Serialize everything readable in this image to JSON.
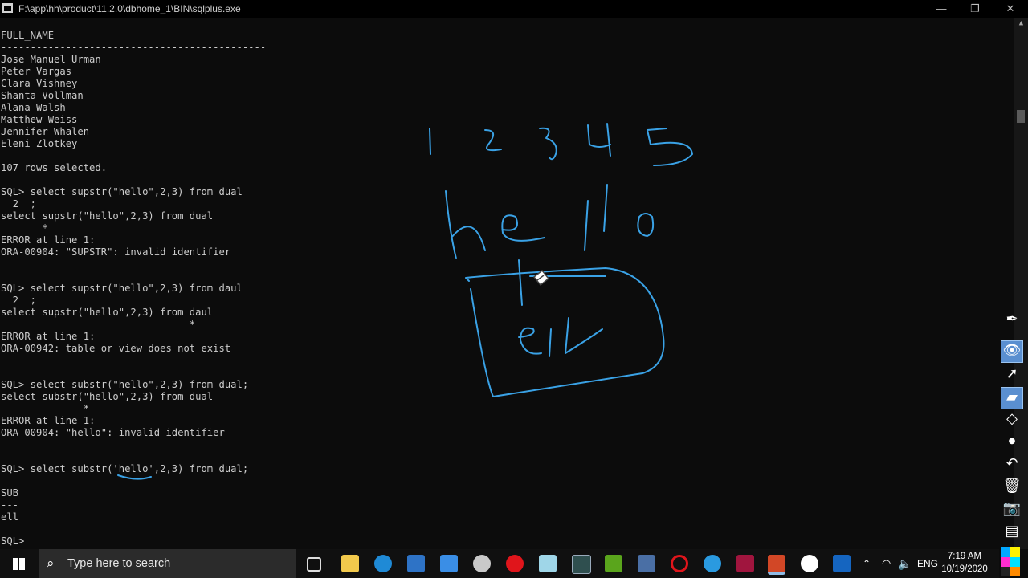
{
  "window": {
    "title": "F:\\app\\hh\\product\\11.2.0\\dbhome_1\\BIN\\sqlplus.exe",
    "min_label": "—",
    "max_label": "❐",
    "close_label": "✕"
  },
  "console": {
    "lines": [
      "FULL_NAME",
      "---------------------------------------------",
      "Jose Manuel Urman",
      "Peter Vargas",
      "Clara Vishney",
      "Shanta Vollman",
      "Alana Walsh",
      "Matthew Weiss",
      "Jennifer Whalen",
      "Eleni Zlotkey",
      "",
      "107 rows selected.",
      "",
      "SQL> select supstr(\"hello\",2,3) from dual",
      "  2  ;",
      "select supstr(\"hello\",2,3) from dual",
      "       *",
      "ERROR at line 1:",
      "ORA-00904: \"SUPSTR\": invalid identifier",
      "",
      "",
      "SQL> select supstr(\"hello\",2,3) from daul",
      "  2  ;",
      "select supstr(\"hello\",2,3) from daul",
      "                                *",
      "ERROR at line 1:",
      "ORA-00942: table or view does not exist",
      "",
      "",
      "SQL> select substr(\"hello\",2,3) from dual;",
      "select substr(\"hello\",2,3) from dual",
      "              *",
      "ERROR at line 1:",
      "ORA-00904: \"hello\": invalid identifier",
      "",
      "",
      "SQL> select substr('hello',2,3) from dual;",
      "",
      "SUB",
      "---",
      "ell",
      "",
      "SQL> "
    ]
  },
  "taskbar": {
    "search_placeholder": "Type here to search",
    "apps": [
      "task-view",
      "file-explorer",
      "edge",
      "store",
      "mail",
      "app-bird",
      "opera",
      "notes",
      "photos",
      "nvidia",
      "network-app",
      "opera-gx",
      "app-blue",
      "app-pink",
      "powerpoint",
      "app-pen",
      "app-window"
    ],
    "language": "ENG",
    "time": "7:19 AM",
    "date": "10/19/2020"
  },
  "colors": {
    "console_bg": "#0c0c0c",
    "console_text": "#cccccc",
    "ink": "#3aa2e6",
    "taskbar_bg": "#101010"
  },
  "annotation_tools": [
    "pen",
    "view",
    "select",
    "highlighter",
    "eraser",
    "dot",
    "undo",
    "delete",
    "screenshot",
    "notes"
  ]
}
